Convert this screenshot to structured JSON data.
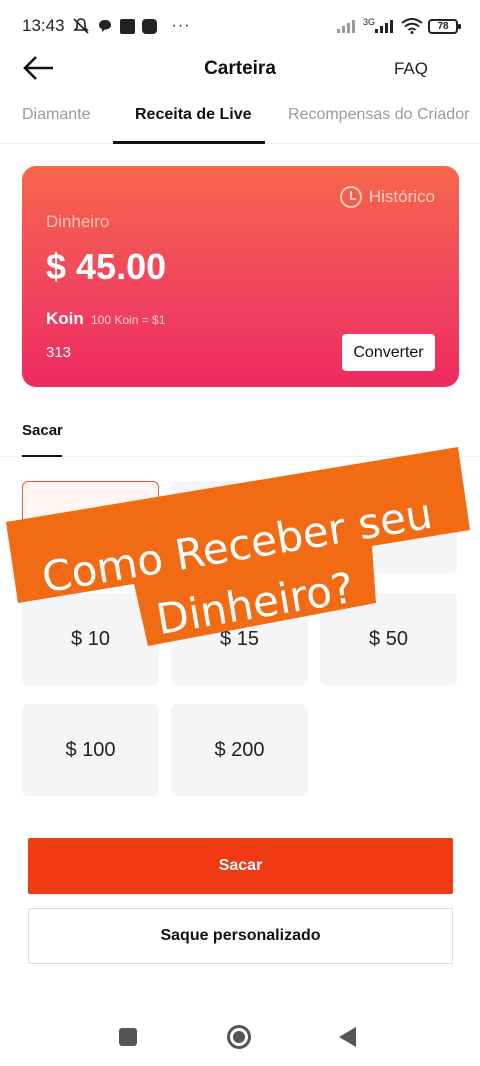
{
  "status_bar": {
    "time": "13:43",
    "more": "···",
    "network": "3G",
    "battery": "78"
  },
  "header": {
    "title": "Carteira",
    "faq": "FAQ"
  },
  "tabs": [
    {
      "label": "Diamante"
    },
    {
      "label": "Receita de Live"
    },
    {
      "label": "Recompensas do Criador"
    }
  ],
  "card": {
    "history": "Histórico",
    "cash_label": "Dinheiro",
    "cash_value": "$ 45.00",
    "koin_label": "Koin",
    "koin_rate": "100 Koin = $1",
    "koin_value": "313",
    "convert": "Converter"
  },
  "withdraw": {
    "section_label": "Sacar",
    "options": [
      "$ 10",
      "$ 15",
      "$ 50",
      "$ 100",
      "$ 200"
    ],
    "button": "Sacar",
    "custom_button": "Saque personalizado"
  },
  "overlay": {
    "line1": "Como Receber seu",
    "line2": "Dinheiro?"
  },
  "colors": {
    "accent": "#ef3a13",
    "card_gradient_top": "#f7664b",
    "card_gradient_bottom": "#ee2a5e",
    "banner": "#f06b14"
  }
}
